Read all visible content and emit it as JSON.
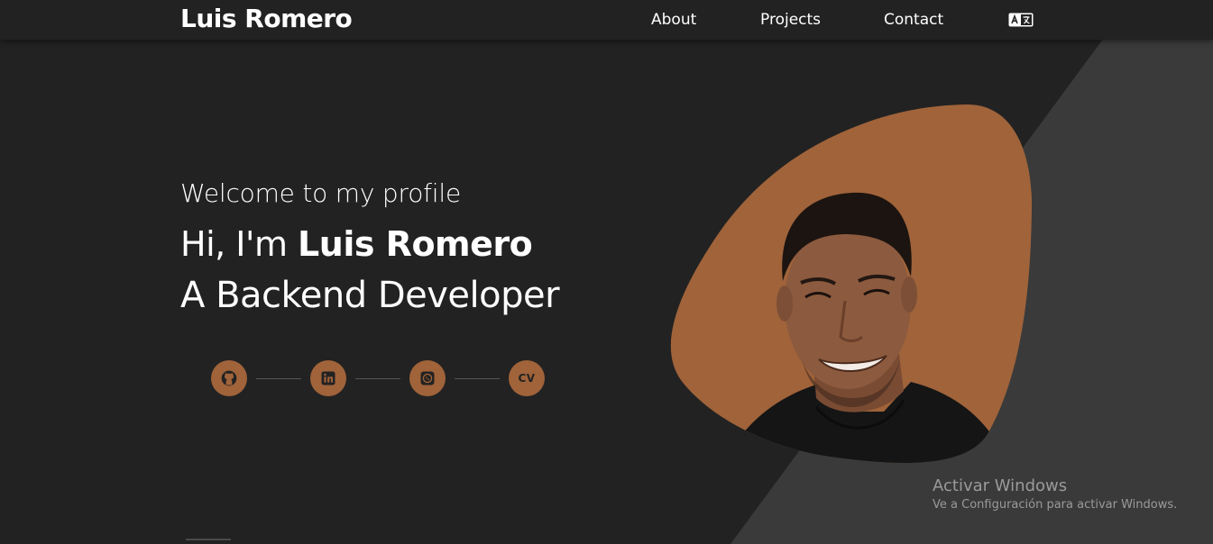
{
  "nav": {
    "brand": "Luis Romero",
    "links": [
      "About",
      "Projects",
      "Contact"
    ],
    "language_icon": "translate-icon"
  },
  "hero": {
    "welcome": "Welcome to my profile",
    "greeting_prefix": "Hi, I'm ",
    "name": "Luis Romero",
    "role": "A Backend Developer"
  },
  "socials": [
    {
      "icon": "github-icon"
    },
    {
      "icon": "linkedin-icon"
    },
    {
      "icon": "whatsapp-icon"
    },
    {
      "icon": "cv-icon",
      "label": "CV"
    }
  ],
  "watermark": {
    "title": "Activar Windows",
    "subtitle": "Ve a Configuración para activar Windows."
  },
  "colors": {
    "background": "#222222",
    "diagonal_panel": "#3a3a3a",
    "accent": "#a0633a",
    "text": "#ffffff"
  }
}
